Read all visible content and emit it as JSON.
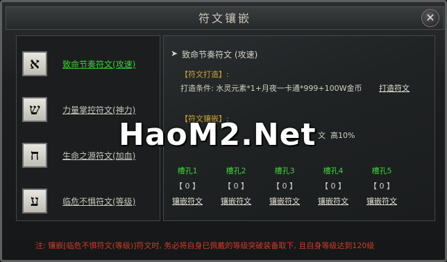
{
  "window": {
    "title": "符文镶嵌",
    "close_label": "✕"
  },
  "runes": [
    {
      "glyph": "א",
      "label": "致命节奏符文(攻速)",
      "active": true
    },
    {
      "glyph": "ש",
      "label": "力量掌控符文(神力)",
      "active": false
    },
    {
      "glyph": "ח",
      "label": "生命之源符文(加血)",
      "active": false
    },
    {
      "glyph": "ע",
      "label": "临危不惧符文(等级)",
      "active": false
    }
  ],
  "detail": {
    "selected_title": "致命节奏符文 (攻速)",
    "forge_section_label": "【符文打造】:",
    "forge_condition": "打造条件: 水灵元素*1+月夜一卡通*999+100W金币",
    "forge_button": "打造符文",
    "inlay_section_label": "【符文镶嵌】:",
    "inlay_partial_text": "文",
    "inlay_partial_pct": "高10%",
    "slots": [
      {
        "name": "槽孔1",
        "value": "【 0 】",
        "button": "镶嵌符文"
      },
      {
        "name": "槽孔2",
        "value": "【 0 】",
        "button": "镶嵌符文"
      },
      {
        "name": "槽孔3",
        "value": "【 0 】",
        "button": "镶嵌符文"
      },
      {
        "name": "槽孔4",
        "value": "【 0 】",
        "button": "镶嵌符文"
      },
      {
        "name": "槽孔5",
        "value": "【 0 】",
        "button": "镶嵌符文"
      }
    ]
  },
  "watermark": "HaoM2.Net",
  "footer_note": "注: 镶嵌[临危不惧符文(等级)]符文时, 务必将自身已佩戴的等级突破装备取下, 且自身等级达到120级",
  "colors": {
    "active_green": "#3fcf3b",
    "section_gold": "#c9a23a",
    "note_red": "#d23a2a"
  }
}
